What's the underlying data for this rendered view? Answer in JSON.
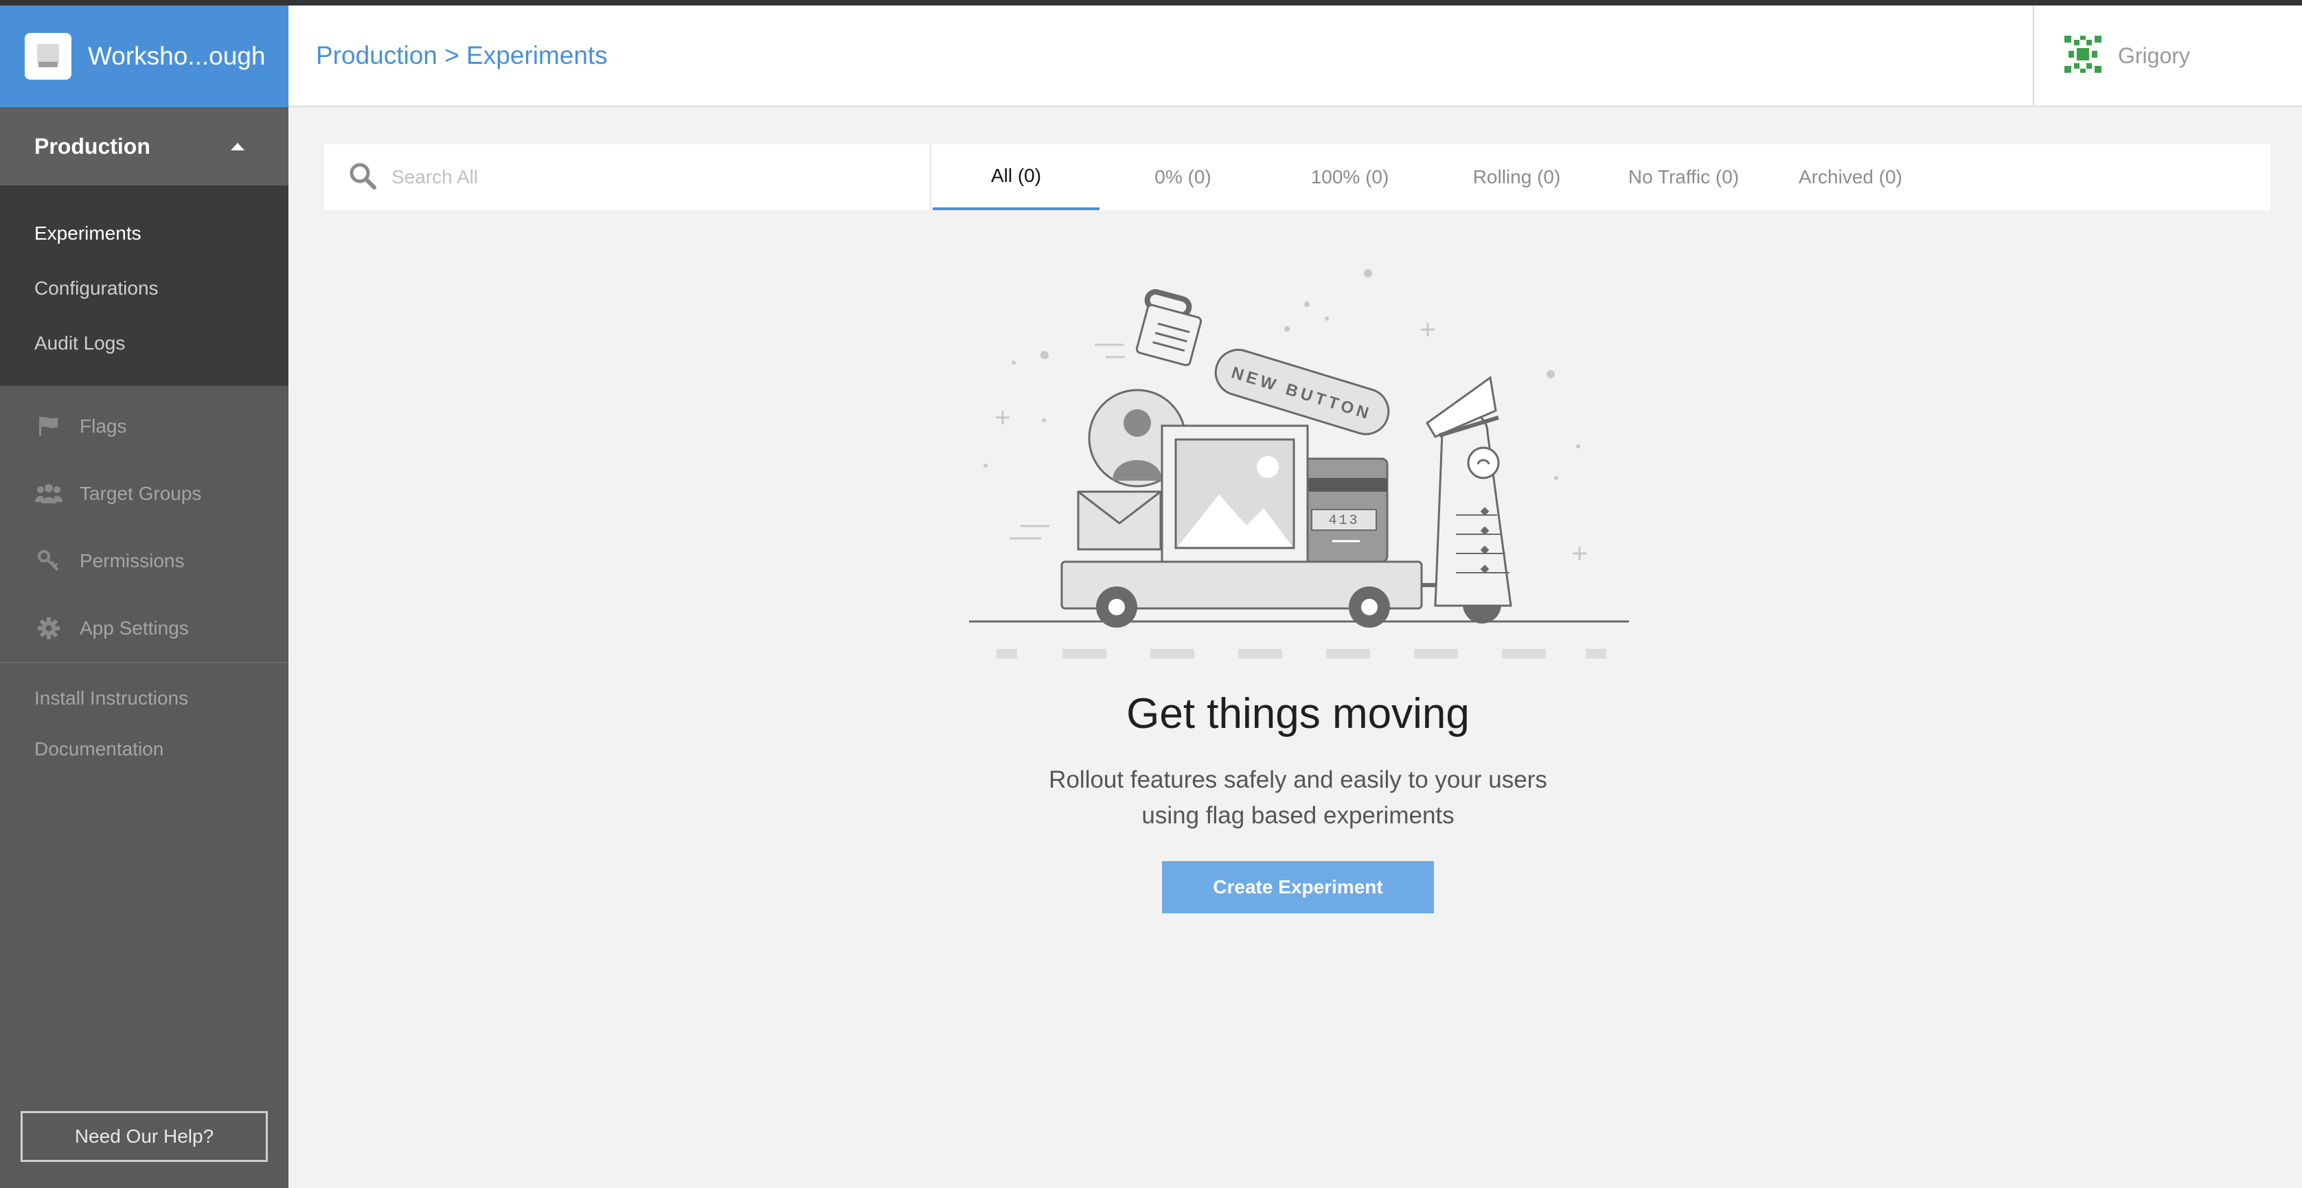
{
  "app": {
    "title": "Worksho...ough",
    "accent_color": "#4a90d9",
    "logo_icon": "app-logo-icon"
  },
  "sidebar": {
    "environment": "Production",
    "subnav": [
      {
        "label": "Experiments",
        "active": true
      },
      {
        "label": "Configurations",
        "active": false
      },
      {
        "label": "Audit Logs",
        "active": false
      }
    ],
    "mainnav": [
      {
        "label": "Flags",
        "icon": "flag-icon"
      },
      {
        "label": "Target Groups",
        "icon": "users-icon"
      },
      {
        "label": "Permissions",
        "icon": "key-icon"
      },
      {
        "label": "App Settings",
        "icon": "gear-icon"
      }
    ],
    "links": [
      "Install Instructions",
      "Documentation"
    ],
    "help_button": "Need Our Help?"
  },
  "header": {
    "breadcrumb": "Production > Experiments",
    "user_name": "Grigory",
    "avatar_icon": "user-avatar-icon"
  },
  "filters": {
    "search_placeholder": "Search All",
    "tabs": [
      {
        "label": "All (0)",
        "active": true
      },
      {
        "label": "0% (0)",
        "active": false
      },
      {
        "label": "100% (0)",
        "active": false
      },
      {
        "label": "Rolling (0)",
        "active": false
      },
      {
        "label": "No Traffic (0)",
        "active": false
      },
      {
        "label": "Archived (0)",
        "active": false
      }
    ]
  },
  "empty_state": {
    "illustration_button_text": "NEW BUTTON",
    "illustration_card_number": "413",
    "title": "Get things moving",
    "subtitle_line1": "Rollout features safely and easily to your users",
    "subtitle_line2": "using flag based experiments",
    "cta": "Create Experiment"
  }
}
